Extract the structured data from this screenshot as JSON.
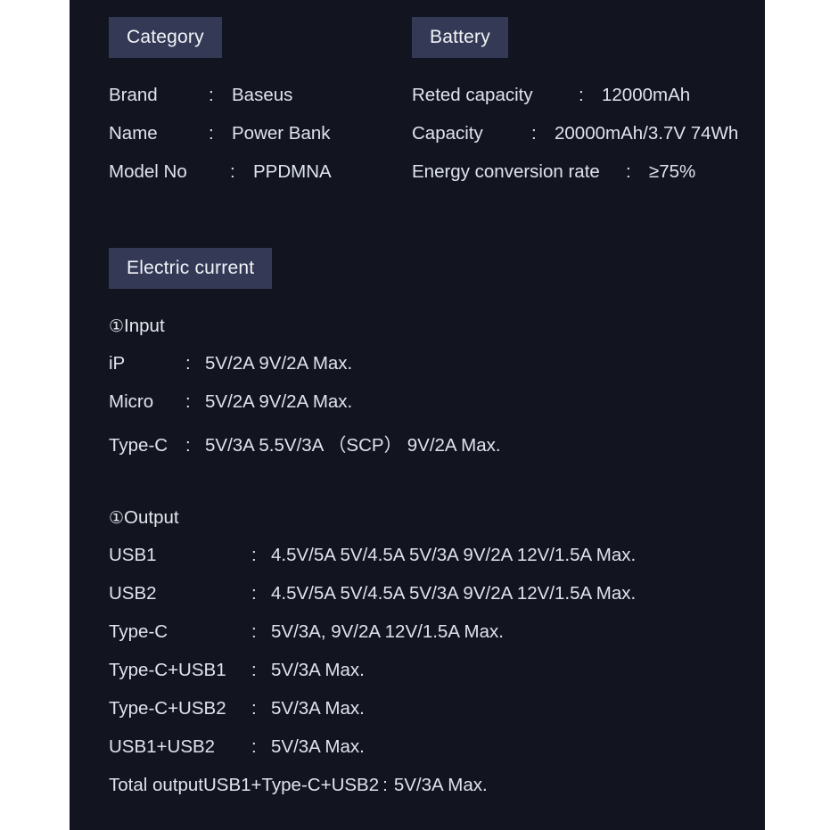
{
  "panel": {
    "background_color": "#12151f",
    "badge_color": "#343a56",
    "text_color": "#dfe3ec"
  },
  "category": {
    "badge": "Category",
    "rows": [
      {
        "label": "Brand",
        "colon": ":",
        "value": "Baseus"
      },
      {
        "label": "Name",
        "colon": ":",
        "value": "Power Bank"
      },
      {
        "label": "Model No",
        "colon": ":",
        "value": "PPDMNA"
      }
    ]
  },
  "battery": {
    "badge": "Battery",
    "rows": [
      {
        "label": "Reted capacity",
        "colon": ":",
        "value": "12000mAh"
      },
      {
        "label": "Capacity",
        "colon": ":",
        "value": "20000mAh/3.7V 74Wh"
      },
      {
        "label": "Energy conversion rate",
        "colon": ":",
        "value": "≥75%"
      }
    ]
  },
  "electric_current": {
    "badge": "Electric current",
    "input": {
      "marker": "①",
      "title": "Input",
      "rows": [
        {
          "label": "iP",
          "colon": ":",
          "value": "5V/2A  9V/2A  Max."
        },
        {
          "label": "Micro",
          "colon": ":",
          "value": "5V/2A  9V/2A  Max."
        },
        {
          "label": "Type-C",
          "colon": ":",
          "value": "5V/3A 5.5V/3A （SCP） 9V/2A Max."
        }
      ]
    },
    "output": {
      "marker": "①",
      "title": "Output",
      "rows": [
        {
          "label": "USB1",
          "colon": ":",
          "value": "4.5V/5A 5V/4.5A  5V/3A 9V/2A 12V/1.5A Max."
        },
        {
          "label": "USB2",
          "colon": ":",
          "value": "4.5V/5A 5V/4.5A  5V/3A 9V/2A 12V/1.5A Max."
        },
        {
          "label": "Type-C",
          "colon": ":",
          "value": "5V/3A, 9V/2A  12V/1.5A Max."
        },
        {
          "label": "Type-C+USB1",
          "colon": ":",
          "value": "5V/3A Max."
        },
        {
          "label": "Type-C+USB2",
          "colon": ":",
          "value": "5V/3A Max."
        },
        {
          "label": "USB1+USB2",
          "colon": ":",
          "value": "5V/3A Max."
        }
      ],
      "total_row": {
        "label": "Total outputUSB1+Type-C+USB2",
        "colon": ":",
        "value": "5V/3A Max."
      }
    }
  }
}
